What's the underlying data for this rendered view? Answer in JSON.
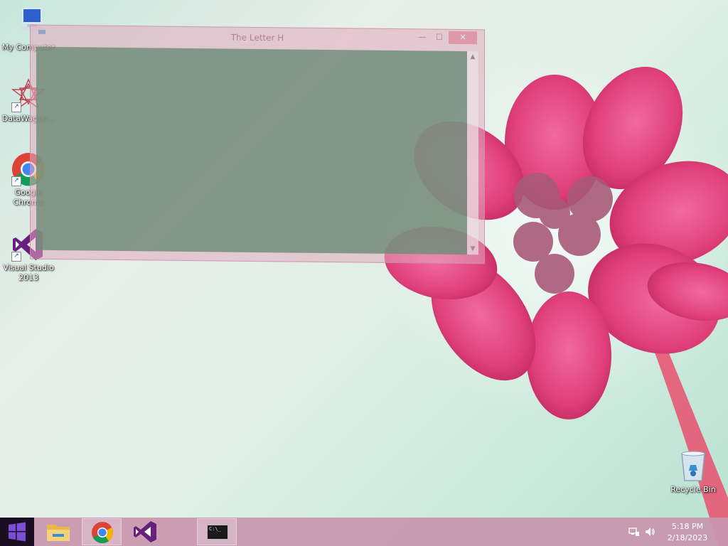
{
  "desktop": {
    "icons": [
      {
        "label": "My Computer",
        "icon": "computer-icon"
      },
      {
        "label": "DataWagon...",
        "icon": "datawagon-icon"
      },
      {
        "label": "Google Chrome",
        "icon": "chrome-icon"
      },
      {
        "label": "Visual Studio 2013",
        "icon": "visual-studio-icon"
      },
      {
        "label": "Recycle Bin",
        "icon": "recycle-bin-icon"
      }
    ]
  },
  "window": {
    "title": "The Letter H",
    "minimize_glyph": "—",
    "maximize_glyph": "☐",
    "close_glyph": "✕"
  },
  "taskbar": {
    "start_icon": "windows-logo-icon",
    "items": [
      {
        "name": "File Explorer",
        "icon": "folder-icon"
      },
      {
        "name": "Google Chrome",
        "icon": "chrome-icon"
      },
      {
        "name": "Visual Studio",
        "icon": "visual-studio-icon"
      },
      {
        "name": "Command Prompt",
        "icon": "cmd-icon",
        "glyph": "C:\\_"
      }
    ],
    "tray": {
      "network_icon": "network-icon",
      "volume_icon": "speaker-icon",
      "time": "5:18 PM",
      "date": "2/18/2023"
    }
  },
  "colors": {
    "taskbar": "#c896af",
    "start": "#1c0e22",
    "window_client": "#6e8c78",
    "flower": "#e0407a"
  }
}
